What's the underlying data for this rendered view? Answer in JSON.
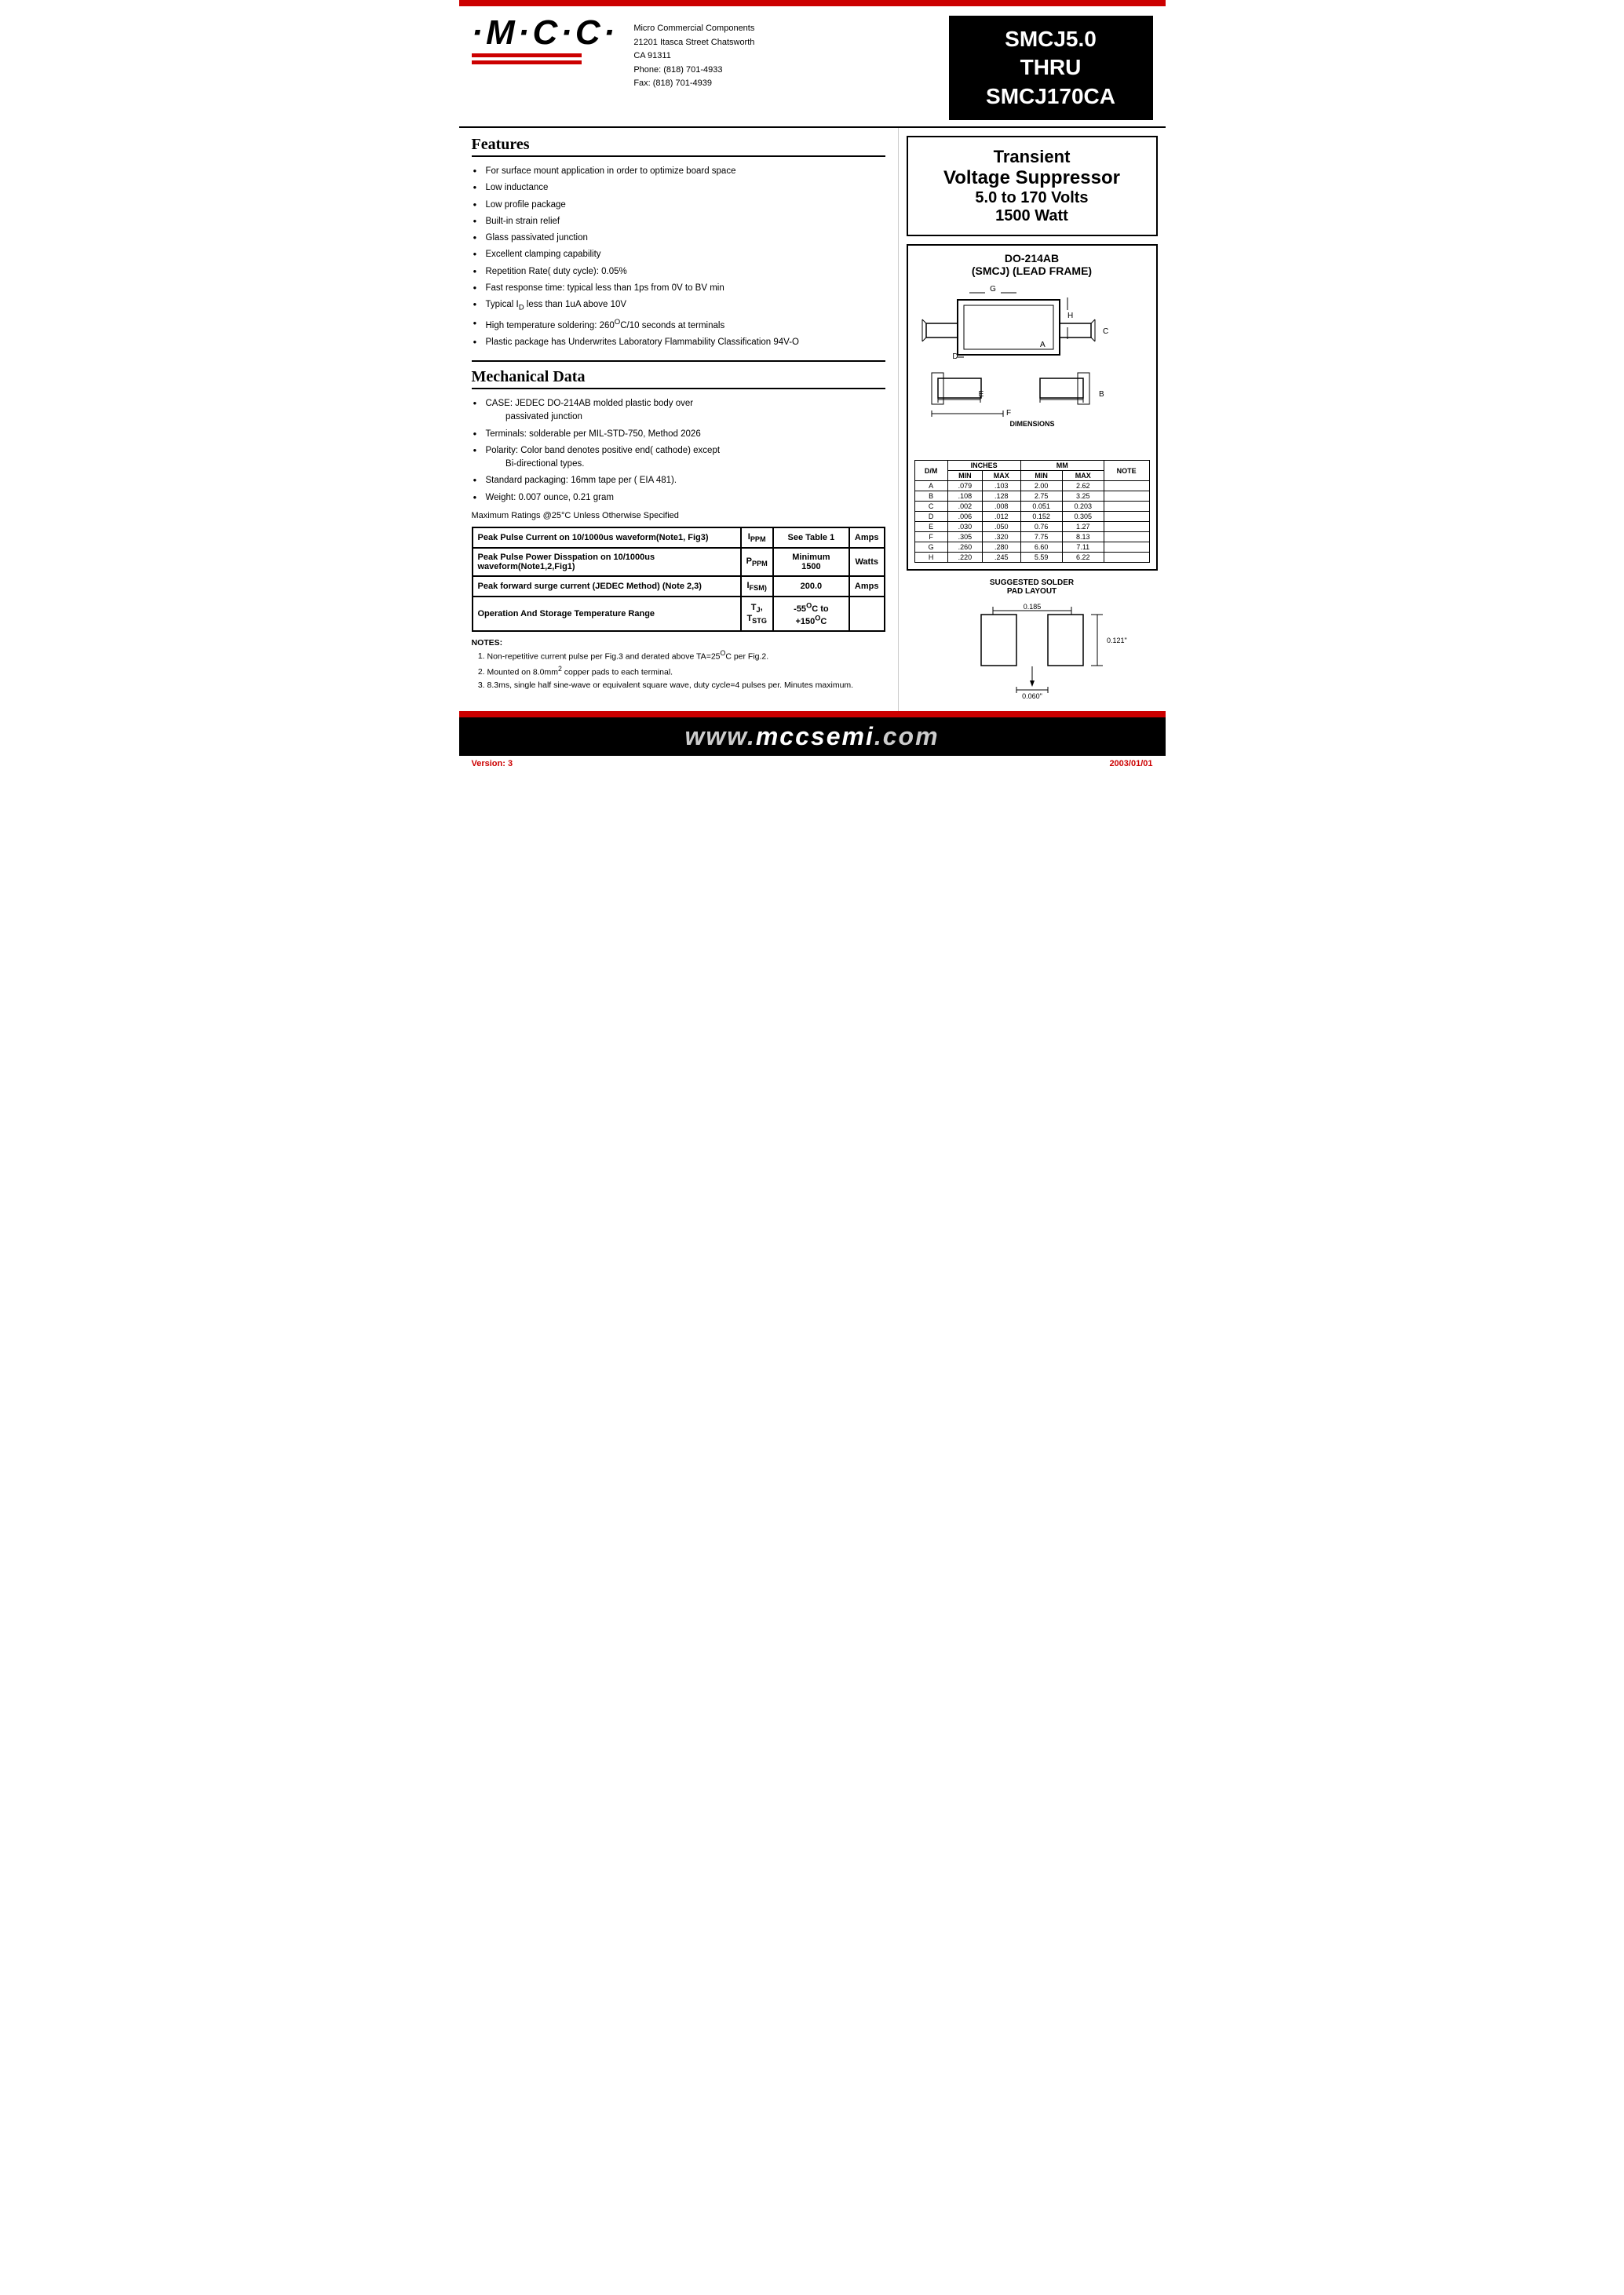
{
  "header": {
    "logo": "·M·C·C·",
    "company_name": "Micro Commercial Components",
    "address": "21201 Itasca Street Chatsworth",
    "city_state": "CA 91311",
    "phone": "Phone: (818) 701-4933",
    "fax": "Fax:    (818) 701-4939",
    "part_number": "SMCJ5.0\nTHRU\nSMCJ170CA"
  },
  "transient": {
    "line1": "Transient",
    "line2": "Voltage Suppressor",
    "line3": "5.0 to 170 Volts",
    "line4": "1500 Watt"
  },
  "package": {
    "title1": "DO-214AB",
    "title2": "(SMCJ) (LEAD FRAME)"
  },
  "features": {
    "title": "Features",
    "items": [
      "For surface mount application in order to optimize board space",
      "Low inductance",
      "Low profile package",
      "Built-in strain relief",
      "Glass passivated junction",
      "Excellent clamping capability",
      "Repetition Rate( duty cycle): 0.05%",
      "Fast response time: typical less than 1ps from 0V to BV min",
      "Typical I₀ less than 1uA above 10V",
      "High temperature soldering: 260°C/10 seconds at terminals",
      "Plastic package has Underwrites Laboratory Flammability Classification 94V-O"
    ]
  },
  "mechanical": {
    "title": "Mechanical Data",
    "items": [
      "CASE: JEDEC DO-214AB molded plastic body over passivated junction",
      "Terminals:   solderable per MIL-STD-750, Method 2026",
      "Polarity: Color band denotes positive end( cathode) except Bi-directional types.",
      "Standard packaging: 16mm tape per ( EIA 481).",
      "Weight: 0.007 ounce, 0.21 gram"
    ]
  },
  "max_ratings_text": "Maximum Ratings @25°C Unless Otherwise Specified",
  "ratings_table": [
    {
      "param": "Peak Pulse Current on 10/1000us waveform(Note1, Fig3)",
      "symbol": "IPPM",
      "value": "See Table 1",
      "unit": "Amps"
    },
    {
      "param": "Peak Pulse Power Disspation on 10/1000us waveform(Note1,2,Fig1)",
      "symbol": "PPPM",
      "value": "Minimum 1500",
      "unit": "Watts"
    },
    {
      "param": "Peak forward surge current (JEDEC Method) (Note 2,3)",
      "symbol": "IFSM",
      "value": "200.0",
      "unit": "Amps"
    },
    {
      "param": "Operation And Storage Temperature Range",
      "symbol": "TJ, TSTG",
      "value": "-55°C to +150°C",
      "unit": ""
    }
  ],
  "notes": {
    "title": "NOTES:",
    "items": [
      "Non-repetitive current pulse per Fig.3 and derated above TA=25°C per Fig.2.",
      "Mounted on 8.0mm² copper pads to each terminal.",
      "8.3ms, single half sine-wave or equivalent square wave, duty cycle=4 pulses per. Minutes maximum."
    ]
  },
  "dimensions": {
    "headers": [
      "D/M",
      "INCHES MIN",
      "INCHES MAX",
      "MM MIN",
      "MM MAX",
      "NOTE"
    ],
    "rows": [
      [
        "A",
        ".079",
        ".103",
        "2.00",
        "2.62",
        ""
      ],
      [
        "B",
        ".108",
        ".128",
        "2.75",
        "3.25",
        ""
      ],
      [
        "C",
        ".002",
        ".008",
        "0.051",
        "0.203",
        ""
      ],
      [
        "D",
        ".006",
        ".012",
        "0.152",
        "0.305",
        ""
      ],
      [
        "E",
        ".030",
        ".050",
        "0.76",
        "1.27",
        ""
      ],
      [
        "F",
        ".305",
        ".320",
        "7.75",
        "8.13",
        ""
      ],
      [
        "G",
        ".260",
        ".280",
        "6.60",
        "7.11",
        ""
      ],
      [
        "H",
        ".220",
        ".245",
        "5.59",
        "6.22",
        ""
      ]
    ]
  },
  "solder_pad": {
    "title": "SUGGESTED SOLDER PAD LAYOUT",
    "dim1": "0.185",
    "dim2": "0.121\"",
    "dim3": "0.060\""
  },
  "footer": {
    "url": "www.mccsemi.com",
    "version_label": "Version: 3",
    "date_label": "2003/01/01"
  }
}
